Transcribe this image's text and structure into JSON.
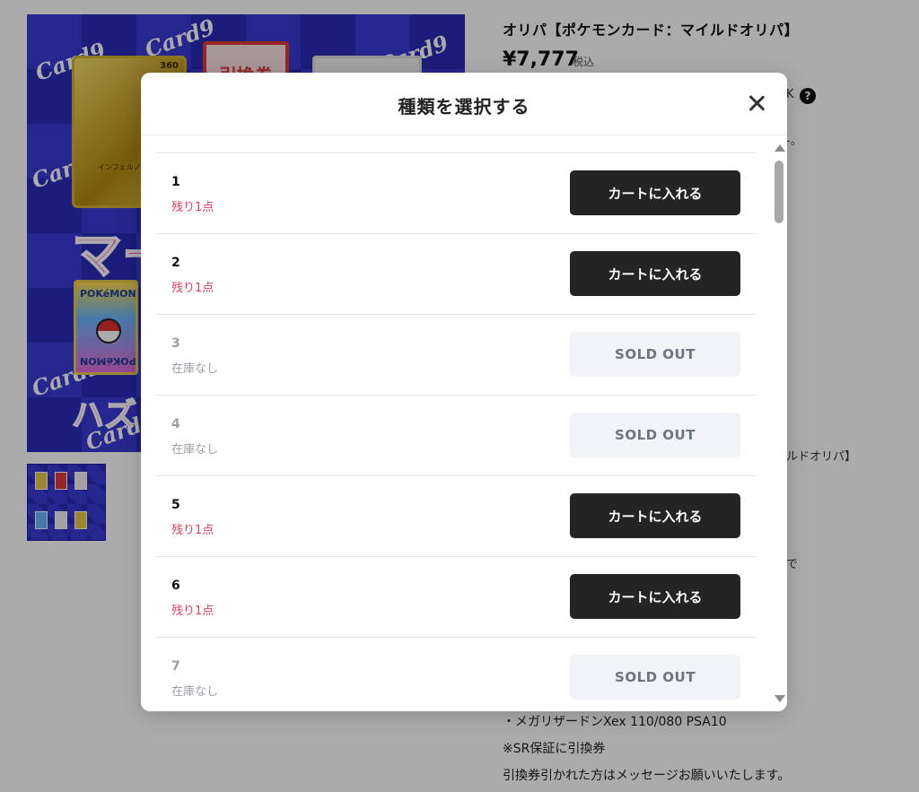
{
  "product": {
    "title": "オリパ【ポケモンカード：マイルドオリパ】",
    "price": "¥7,777",
    "tax_label": "税込",
    "ok_fragment": "K",
    "fragment_1": "-。",
    "fragment_2": "ルドオリパ】",
    "fragment_3": "で",
    "image_texts": {
      "brand": "Card9",
      "ticket": "引換券",
      "big_text": "マー",
      "hazure": "ハズレ",
      "pokemon_logo": "POKéMON",
      "card_hp": "360",
      "card_attack": "インフェルノ"
    },
    "description_lines": [
      "・メガリザードンXex 110/080 PSA10",
      "※SR保証に引換券",
      "引換券引かれた方はメッセージお願いいたします。"
    ]
  },
  "modal": {
    "title": "種類を選択する",
    "close_icon": "close-icon",
    "variants": [
      {
        "name": "1",
        "stock": "残り1点",
        "button": "カートに入れる",
        "sold_out": false
      },
      {
        "name": "2",
        "stock": "残り1点",
        "button": "カートに入れる",
        "sold_out": false
      },
      {
        "name": "3",
        "stock": "在庫なし",
        "button": "SOLD OUT",
        "sold_out": true
      },
      {
        "name": "4",
        "stock": "在庫なし",
        "button": "SOLD OUT",
        "sold_out": true
      },
      {
        "name": "5",
        "stock": "残り1点",
        "button": "カートに入れる",
        "sold_out": false
      },
      {
        "name": "6",
        "stock": "残り1点",
        "button": "カートに入れる",
        "sold_out": false
      },
      {
        "name": "7",
        "stock": "在庫なし",
        "button": "SOLD OUT",
        "sold_out": true
      }
    ]
  },
  "colors": {
    "cart_button": "#242424",
    "soldout_button": "#f2f3f6",
    "stock_red": "#e0405a",
    "soldout_text": "#9aa0a8",
    "overlay": "rgba(0,0,0,0.33)"
  }
}
